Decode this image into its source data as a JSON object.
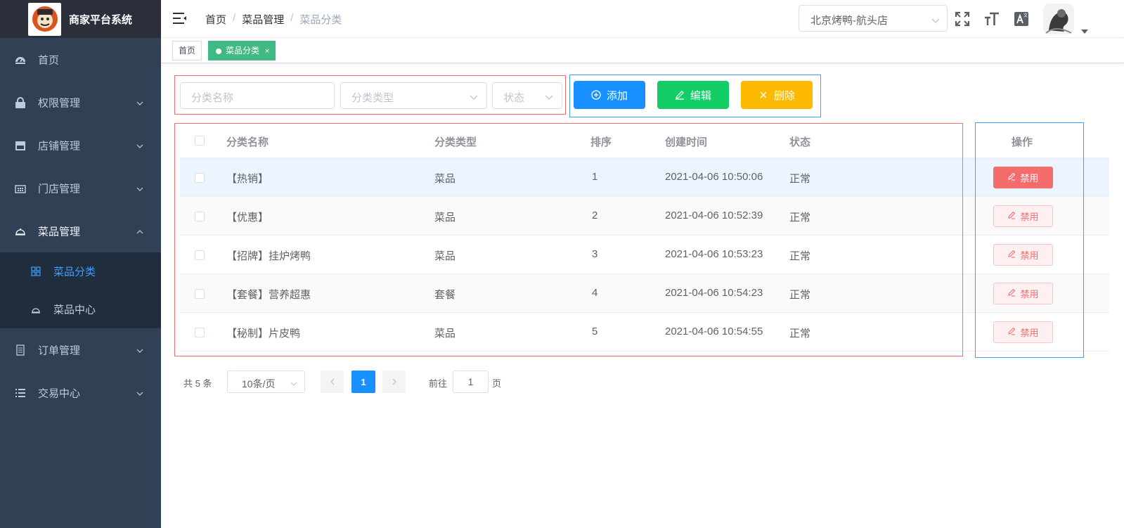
{
  "app": {
    "title": "商家平台系统"
  },
  "sidebar": {
    "items": [
      {
        "label": "首页",
        "icon": "dashboard-icon"
      },
      {
        "label": "权限管理",
        "icon": "lock-icon"
      },
      {
        "label": "店铺管理",
        "icon": "shop-icon"
      },
      {
        "label": "门店管理",
        "icon": "store-icon"
      },
      {
        "label": "菜品管理",
        "icon": "dish-icon"
      },
      {
        "label": "订单管理",
        "icon": "order-icon"
      },
      {
        "label": "交易中心",
        "icon": "list-icon"
      }
    ],
    "submenu": [
      {
        "label": "菜品分类",
        "icon": "grid-icon"
      },
      {
        "label": "菜品中心",
        "icon": "dish-icon"
      }
    ]
  },
  "navbar": {
    "breadcrumb": [
      "首页",
      "菜品管理",
      "菜品分类"
    ],
    "store_value": "北京烤鸭-航头店"
  },
  "tags": {
    "home": "首页",
    "active": "菜品分类",
    "close": "×"
  },
  "filters": {
    "name_placeholder": "分类名称",
    "type_placeholder": "分类类型",
    "status_placeholder": "状态"
  },
  "actions": {
    "add": "添加",
    "edit": "编辑",
    "delete": "删除"
  },
  "table": {
    "headers": [
      "分类名称",
      "分类类型",
      "排序",
      "创建时间",
      "状态",
      "操作"
    ],
    "rows": [
      {
        "name": "【热销】",
        "type": "菜品",
        "sort": "1",
        "created": "2021-04-06 10:50:06",
        "status": "正常",
        "action": "禁用"
      },
      {
        "name": "【优惠】",
        "type": "菜品",
        "sort": "2",
        "created": "2021-04-06 10:52:39",
        "status": "正常",
        "action": "禁用"
      },
      {
        "name": "【招牌】挂炉烤鸭",
        "type": "菜品",
        "sort": "3",
        "created": "2021-04-06 10:53:23",
        "status": "正常",
        "action": "禁用"
      },
      {
        "name": "【套餐】营养超惠",
        "type": "套餐",
        "sort": "4",
        "created": "2021-04-06 10:54:23",
        "status": "正常",
        "action": "禁用"
      },
      {
        "name": "【秘制】片皮鸭",
        "type": "菜品",
        "sort": "5",
        "created": "2021-04-06 10:54:55",
        "status": "正常",
        "action": "禁用"
      }
    ]
  },
  "pagination": {
    "total": "共 5 条",
    "page_size": "10条/页",
    "current": "1",
    "goto_label": "前往",
    "goto_value": "1",
    "goto_unit": "页"
  },
  "colors": {
    "sidebar_bg": "#304156",
    "primary": "#1890ff",
    "success": "#13ce66",
    "warning": "#ffba00",
    "danger": "#ff4949",
    "tag_active": "#42b983"
  }
}
